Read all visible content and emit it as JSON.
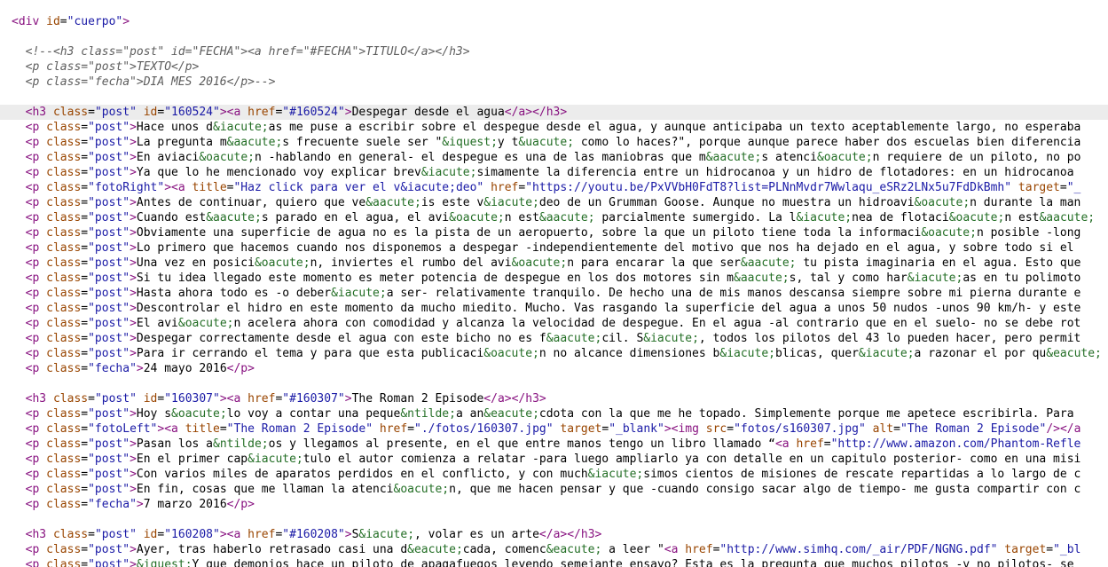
{
  "editor": {
    "current_line": 6,
    "colors": {
      "tag": "#881280",
      "attribute": "#994500",
      "attribute_value": "#1a1aa6",
      "entity": "#236e25",
      "comment": "#5d5d5d",
      "text": "#000000",
      "current_line_bg": "#ececec"
    },
    "lines": [
      [
        "<div",
        "t",
        " id",
        "a",
        "=",
        "x",
        "\"cuerpo\"",
        "v",
        ">",
        "t"
      ],
      [],
      [
        "  ",
        "x",
        "<!--<h3 class=\"post\" id=\"FECHA\"><a href=\"#FECHA\">TITULO</a></h3>",
        "cm"
      ],
      [
        "  ",
        "x",
        "<p class=\"post\">TEXTO</p>",
        "cm"
      ],
      [
        "  ",
        "x",
        "<p class=\"fecha\">DIA MES 2016</p>-->",
        "cm"
      ],
      [],
      [
        "  ",
        "x",
        "<h3",
        "t",
        " class",
        "a",
        "=",
        "x",
        "\"post\"",
        "v",
        " id",
        "a",
        "=",
        "x",
        "\"160524\"",
        "v",
        "><a",
        "t",
        " href",
        "a",
        "=",
        "x",
        "\"#160524\"",
        "v",
        ">",
        "t",
        "Despegar desde el agua",
        "x",
        "</a></h3>",
        "t"
      ],
      [
        "  ",
        "x",
        "<p",
        "t",
        " class",
        "a",
        "=",
        "x",
        "\"post\"",
        "v",
        ">",
        "t",
        "Hace unos d",
        "x",
        "&iacute;",
        "c",
        "as me puse a escribir sobre el despegue desde el agua, y aunque anticipaba un texto aceptablemente largo, no esperaba",
        "x"
      ],
      [
        "  ",
        "x",
        "<p",
        "t",
        " class",
        "a",
        "=",
        "x",
        "\"post\"",
        "v",
        ">",
        "t",
        "La pregunta m",
        "x",
        "&aacute;",
        "c",
        "s frecuente suele ser \"",
        "x",
        "&iquest;",
        "c",
        "y t",
        "x",
        "&uacute;",
        "c",
        " como lo haces?\", porque aunque parece haber dos escuelas bien diferencia",
        "x"
      ],
      [
        "  ",
        "x",
        "<p",
        "t",
        " class",
        "a",
        "=",
        "x",
        "\"post\"",
        "v",
        ">",
        "t",
        "En aviaci",
        "x",
        "&oacute;",
        "c",
        "n -hablando en general- el despegue es una de las maniobras que m",
        "x",
        "&aacute;",
        "c",
        "s atenci",
        "x",
        "&oacute;",
        "c",
        "n requiere de un piloto, no po",
        "x"
      ],
      [
        "  ",
        "x",
        "<p",
        "t",
        " class",
        "a",
        "=",
        "x",
        "\"post\"",
        "v",
        ">",
        "t",
        "Ya que lo he mencionado voy explicar brev",
        "x",
        "&iacute;",
        "c",
        "simamente la diferencia entre un hidrocanoa y un hidro de flotadores: en un hidrocanoa",
        "x"
      ],
      [
        "  ",
        "x",
        "<p",
        "t",
        " class",
        "a",
        "=",
        "x",
        "\"fotoRight\"",
        "v",
        "><a",
        "t",
        " title",
        "a",
        "=",
        "x",
        "\"Haz click para ver el v&iacute;deo\"",
        "v",
        " href",
        "a",
        "=",
        "x",
        "\"https://youtu.be/PxVVbH0FdT8?list=PLNnMvdr7Wwlaqu_eSRz2LNx5u7FdDkBmh\"",
        "v",
        " target",
        "a",
        "=",
        "x",
        "\"_",
        "v"
      ],
      [
        "  ",
        "x",
        "<p",
        "t",
        " class",
        "a",
        "=",
        "x",
        "\"post\"",
        "v",
        ">",
        "t",
        "Antes de continuar, quiero que ve",
        "x",
        "&aacute;",
        "c",
        "is este v",
        "x",
        "&iacute;",
        "c",
        "deo de un Grumman Goose. Aunque no muestra un hidroavi",
        "x",
        "&oacute;",
        "c",
        "n durante la man",
        "x"
      ],
      [
        "  ",
        "x",
        "<p",
        "t",
        " class",
        "a",
        "=",
        "x",
        "\"post\"",
        "v",
        ">",
        "t",
        "Cuando est",
        "x",
        "&aacute;",
        "c",
        "s parado en el agua, el avi",
        "x",
        "&oacute;",
        "c",
        "n est",
        "x",
        "&aacute;",
        "c",
        " parcialmente sumergido. La l",
        "x",
        "&iacute;",
        "c",
        "nea de flotaci",
        "x",
        "&oacute;",
        "c",
        "n est",
        "x",
        "&aacute;",
        "c"
      ],
      [
        "  ",
        "x",
        "<p",
        "t",
        " class",
        "a",
        "=",
        "x",
        "\"post\"",
        "v",
        ">",
        "t",
        "Obviamente una superficie de agua no es la pista de un aeropuerto, sobre la que un piloto tiene toda la informaci",
        "x",
        "&oacute;",
        "c",
        "n posible -long",
        "x"
      ],
      [
        "  ",
        "x",
        "<p",
        "t",
        " class",
        "a",
        "=",
        "x",
        "\"post\"",
        "v",
        ">",
        "t",
        "Lo primero que hacemos cuando nos disponemos a despegar -independientemente del motivo que nos ha dejado en el agua, y sobre todo si el",
        "x"
      ],
      [
        "  ",
        "x",
        "<p",
        "t",
        " class",
        "a",
        "=",
        "x",
        "\"post\"",
        "v",
        ">",
        "t",
        "Una vez en posici",
        "x",
        "&oacute;",
        "c",
        "n, inviertes el rumbo del avi",
        "x",
        "&oacute;",
        "c",
        "n para encarar la que ser",
        "x",
        "&aacute;",
        "c",
        " tu pista imaginaria en el agua. Esto que",
        "x"
      ],
      [
        "  ",
        "x",
        "<p",
        "t",
        " class",
        "a",
        "=",
        "x",
        "\"post\"",
        "v",
        ">",
        "t",
        "Si tu idea llegado este momento es meter potencia de despegue en los dos motores sin m",
        "x",
        "&aacute;",
        "c",
        "s, tal y como har",
        "x",
        "&iacute;",
        "c",
        "as en tu polimoto",
        "x"
      ],
      [
        "  ",
        "x",
        "<p",
        "t",
        " class",
        "a",
        "=",
        "x",
        "\"post\"",
        "v",
        ">",
        "t",
        "Hasta ahora todo es -o deber",
        "x",
        "&iacute;",
        "c",
        "a ser- relativamente tranquilo. De hecho una de mis manos descansa siempre sobre mi pierna durante e",
        "x"
      ],
      [
        "  ",
        "x",
        "<p",
        "t",
        " class",
        "a",
        "=",
        "x",
        "\"post\"",
        "v",
        ">",
        "t",
        "Descontrolar el hidro en este momento da mucho miedito. Mucho. Vas rasgando la superficie del agua a unos 50 nudos -unos 90 km/h- y este",
        "x"
      ],
      [
        "  ",
        "x",
        "<p",
        "t",
        " class",
        "a",
        "=",
        "x",
        "\"post\"",
        "v",
        ">",
        "t",
        "El avi",
        "x",
        "&oacute;",
        "c",
        "n acelera ahora con comodidad y alcanza la velocidad de despegue. En el agua -al contrario que en el suelo- no se debe rot",
        "x"
      ],
      [
        "  ",
        "x",
        "<p",
        "t",
        " class",
        "a",
        "=",
        "x",
        "\"post\"",
        "v",
        ">",
        "t",
        "Despegar correctamente desde el agua con este bicho no es f",
        "x",
        "&aacute;",
        "c",
        "cil. S",
        "x",
        "&iacute;",
        "c",
        ", todos los pilotos del 43 lo pueden hacer, pero permit",
        "x"
      ],
      [
        "  ",
        "x",
        "<p",
        "t",
        " class",
        "a",
        "=",
        "x",
        "\"post\"",
        "v",
        ">",
        "t",
        "Para ir cerrando el tema y para que esta publicaci",
        "x",
        "&oacute;",
        "c",
        "n no alcance dimensiones b",
        "x",
        "&iacute;",
        "c",
        "blicas, quer",
        "x",
        "&iacute;",
        "c",
        "a razonar el por qu",
        "x",
        "&eacute;",
        "c"
      ],
      [
        "  ",
        "x",
        "<p",
        "t",
        " class",
        "a",
        "=",
        "x",
        "\"fecha\"",
        "v",
        ">",
        "t",
        "24 mayo 2016",
        "x",
        "</p>",
        "t"
      ],
      [],
      [
        "  ",
        "x",
        "<h3",
        "t",
        " class",
        "a",
        "=",
        "x",
        "\"post\"",
        "v",
        " id",
        "a",
        "=",
        "x",
        "\"160307\"",
        "v",
        "><a",
        "t",
        " href",
        "a",
        "=",
        "x",
        "\"#160307\"",
        "v",
        ">",
        "t",
        "The Roman 2 Episode",
        "x",
        "</a></h3>",
        "t"
      ],
      [
        "  ",
        "x",
        "<p",
        "t",
        " class",
        "a",
        "=",
        "x",
        "\"post\"",
        "v",
        ">",
        "t",
        "Hoy s",
        "x",
        "&oacute;",
        "c",
        "lo voy a contar una peque",
        "x",
        "&ntilde;",
        "c",
        "a an",
        "x",
        "&eacute;",
        "c",
        "cdota con la que me he topado. Simplemente porque me apetece escribirla. Para",
        "x"
      ],
      [
        "  ",
        "x",
        "<p",
        "t",
        " class",
        "a",
        "=",
        "x",
        "\"fotoLeft\"",
        "v",
        "><a",
        "t",
        " title",
        "a",
        "=",
        "x",
        "\"The Roman 2 Episode\"",
        "v",
        " href",
        "a",
        "=",
        "x",
        "\"./fotos/160307.jpg\"",
        "v",
        " target",
        "a",
        "=",
        "x",
        "\"_blank\"",
        "v",
        "><img",
        "t",
        " src",
        "a",
        "=",
        "x",
        "\"fotos/s160307.jpg\"",
        "v",
        " alt",
        "a",
        "=",
        "x",
        "\"The Roman 2 Episode\"",
        "v",
        "/></a",
        "t"
      ],
      [
        "  ",
        "x",
        "<p",
        "t",
        " class",
        "a",
        "=",
        "x",
        "\"post\"",
        "v",
        ">",
        "t",
        "Pasan los a",
        "x",
        "&ntilde;",
        "c",
        "os y llegamos al presente, en el que entre manos tengo un libro llamado “",
        "x",
        "<a",
        "t",
        " href",
        "a",
        "=",
        "x",
        "\"http://www.amazon.com/Phantom-Refle",
        "v"
      ],
      [
        "  ",
        "x",
        "<p",
        "t",
        " class",
        "a",
        "=",
        "x",
        "\"post\"",
        "v",
        ">",
        "t",
        "En el primer cap",
        "x",
        "&iacute;",
        "c",
        "tulo el autor comienza a relatar -para luego ampliarlo ya con detalle en un capitulo posterior- como en una misi",
        "x"
      ],
      [
        "  ",
        "x",
        "<p",
        "t",
        " class",
        "a",
        "=",
        "x",
        "\"post\"",
        "v",
        ">",
        "t",
        "Con varios miles de aparatos perdidos en el conflicto, y con much",
        "x",
        "&iacute;",
        "c",
        "simos cientos de misiones de rescate repartidas a lo largo de c",
        "x"
      ],
      [
        "  ",
        "x",
        "<p",
        "t",
        " class",
        "a",
        "=",
        "x",
        "\"post\"",
        "v",
        ">",
        "t",
        "En fin, cosas que me llaman la atenci",
        "x",
        "&oacute;",
        "c",
        "n, que me hacen pensar y que -cuando consigo sacar algo de tiempo- me gusta compartir con c",
        "x"
      ],
      [
        "  ",
        "x",
        "<p",
        "t",
        " class",
        "a",
        "=",
        "x",
        "\"fecha\"",
        "v",
        ">",
        "t",
        "7 marzo 2016",
        "x",
        "</p>",
        "t"
      ],
      [],
      [
        "  ",
        "x",
        "<h3",
        "t",
        " class",
        "a",
        "=",
        "x",
        "\"post\"",
        "v",
        " id",
        "a",
        "=",
        "x",
        "\"160208\"",
        "v",
        "><a",
        "t",
        " href",
        "a",
        "=",
        "x",
        "\"#160208\"",
        "v",
        ">",
        "t",
        "S",
        "x",
        "&iacute;",
        "c",
        ", volar es un arte",
        "x",
        "</a></h3>",
        "t"
      ],
      [
        "  ",
        "x",
        "<p",
        "t",
        " class",
        "a",
        "=",
        "x",
        "\"post\"",
        "v",
        ">",
        "t",
        "Ayer, tras haberlo retrasado casi una d",
        "x",
        "&eacute;",
        "c",
        "cada, comenc",
        "x",
        "&eacute;",
        "c",
        " a leer \"",
        "x",
        "<a",
        "t",
        " href",
        "a",
        "=",
        "x",
        "\"http://www.simhq.com/_air/PDF/NGNG.pdf\"",
        "v",
        " target",
        "a",
        "=",
        "x",
        "\"_bl",
        "v"
      ],
      [
        "  ",
        "x",
        "<p",
        "t",
        " class",
        "a",
        "=",
        "x",
        "\"post\"",
        "v",
        ">",
        "t",
        "&iquest;",
        "c",
        "Y que demonios hace un piloto de apagafuegos leyendo semejante ensayo? Esta es la pregunta que muchos pilotos -y no pilotos- se",
        "x"
      ]
    ]
  }
}
